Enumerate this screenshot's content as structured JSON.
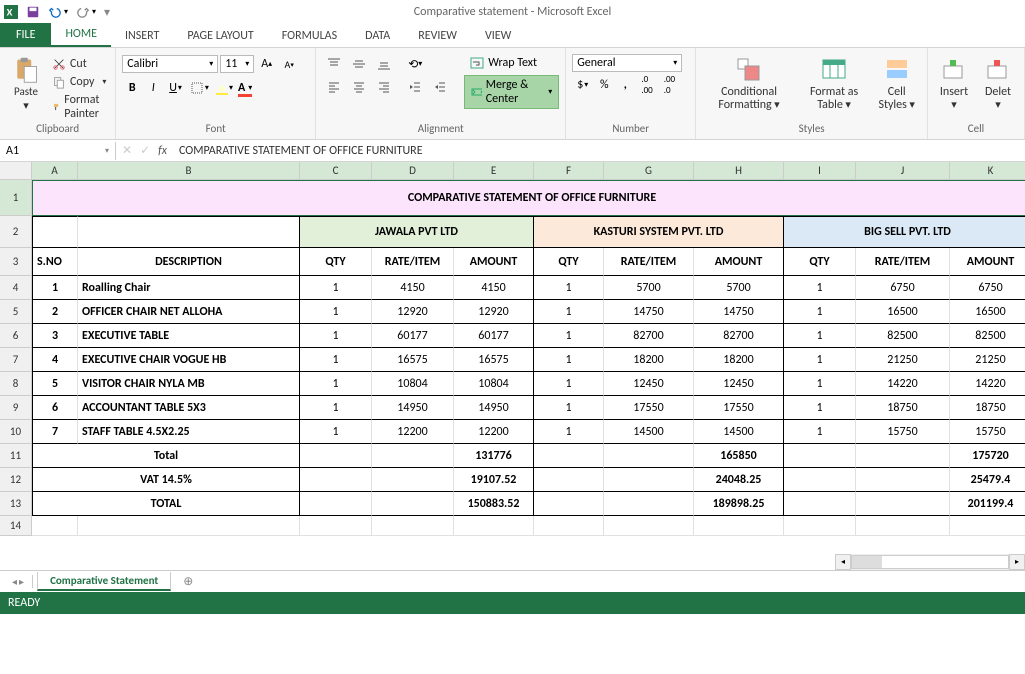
{
  "app": {
    "title": "Comparative statement - Microsoft Excel"
  },
  "tabs": {
    "file": "FILE",
    "home": "HOME",
    "insert": "INSERT",
    "pagelayout": "PAGE LAYOUT",
    "formulas": "FORMULAS",
    "data": "DATA",
    "review": "REVIEW",
    "view": "VIEW"
  },
  "ribbon": {
    "clipboard": {
      "label": "Clipboard",
      "paste": "Paste",
      "cut": "Cut",
      "copy": "Copy",
      "painter": "Format Painter"
    },
    "font": {
      "label": "Font",
      "name": "Calibri",
      "size": "11"
    },
    "alignment": {
      "label": "Alignment",
      "wrap": "Wrap Text",
      "merge": "Merge & Center"
    },
    "number": {
      "label": "Number",
      "format": "General"
    },
    "styles": {
      "label": "Styles",
      "cond": "Conditional Formatting",
      "fmt": "Format as Table",
      "cell": "Cell Styles"
    },
    "cells": {
      "label": "Cell",
      "insert": "Insert",
      "delete": "Delet"
    }
  },
  "formula": {
    "cell": "A1",
    "text": "COMPARATIVE STATEMENT OF OFFICE FURNITURE"
  },
  "cols": [
    "A",
    "B",
    "C",
    "D",
    "E",
    "F",
    "G",
    "H",
    "I",
    "J",
    "K"
  ],
  "data": {
    "title": "COMPARATIVE STATEMENT OF OFFICE FURNITURE",
    "vendors": [
      "JAWALA PVT LTD",
      "KASTURI SYSTEM PVT. LTD",
      "BIG SELL PVT. LTD"
    ],
    "headers": {
      "sno": "S.NO",
      "desc": "DESCRIPTION",
      "qty": "QTY",
      "rate": "RATE/ITEM",
      "amount": "AMOUNT"
    },
    "rows": [
      {
        "sno": "1",
        "desc": "Roalling Chair",
        "q1": "1",
        "r1": "4150",
        "a1": "4150",
        "q2": "1",
        "r2": "5700",
        "a2": "5700",
        "q3": "1",
        "r3": "6750",
        "a3": "6750"
      },
      {
        "sno": "2",
        "desc": "OFFICER CHAIR NET ALLOHA",
        "q1": "1",
        "r1": "12920",
        "a1": "12920",
        "q2": "1",
        "r2": "14750",
        "a2": "14750",
        "q3": "1",
        "r3": "16500",
        "a3": "16500"
      },
      {
        "sno": "3",
        "desc": "EXECUTIVE TABLE",
        "q1": "1",
        "r1": "60177",
        "a1": "60177",
        "q2": "1",
        "r2": "82700",
        "a2": "82700",
        "q3": "1",
        "r3": "82500",
        "a3": "82500"
      },
      {
        "sno": "4",
        "desc": "EXECUTIVE CHAIR VOGUE HB",
        "q1": "1",
        "r1": "16575",
        "a1": "16575",
        "q2": "1",
        "r2": "18200",
        "a2": "18200",
        "q3": "1",
        "r3": "21250",
        "a3": "21250"
      },
      {
        "sno": "5",
        "desc": "VISITOR CHAIR NYLA MB",
        "q1": "1",
        "r1": "10804",
        "a1": "10804",
        "q2": "1",
        "r2": "12450",
        "a2": "12450",
        "q3": "1",
        "r3": "14220",
        "a3": "14220"
      },
      {
        "sno": "6",
        "desc": "ACCOUNTANT TABLE 5X3",
        "q1": "1",
        "r1": "14950",
        "a1": "14950",
        "q2": "1",
        "r2": "17550",
        "a2": "17550",
        "q3": "1",
        "r3": "18750",
        "a3": "18750"
      },
      {
        "sno": "7",
        "desc": "STAFF TABLE 4.5X2.25",
        "q1": "1",
        "r1": "12200",
        "a1": "12200",
        "q2": "1",
        "r2": "14500",
        "a2": "14500",
        "q3": "1",
        "r3": "15750",
        "a3": "15750"
      }
    ],
    "totals": {
      "total_label": "Total",
      "t1": "131776",
      "t2": "165850",
      "t3": "175720",
      "vat_label": "VAT 14.5%",
      "v1": "19107.52",
      "v2": "24048.25",
      "v3": "25479.4",
      "grand_label": "TOTAL",
      "g1": "150883.52",
      "g2": "189898.25",
      "g3": "201199.4"
    }
  },
  "sheet": {
    "name": "Comparative Statement"
  },
  "status": {
    "text": "READY"
  }
}
